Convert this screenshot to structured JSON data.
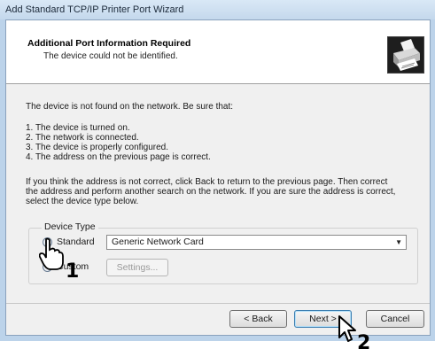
{
  "window": {
    "title": "Add Standard TCP/IP Printer Port Wizard"
  },
  "header": {
    "title": "Additional Port Information Required",
    "subtitle": "The device could not be identified."
  },
  "body": {
    "intro": "The device is not found on the network.  Be sure that:",
    "list": [
      "1.  The device is turned on.",
      "2.  The network is connected.",
      "3.  The device is properly configured.",
      "4.  The address on the previous page is correct."
    ],
    "paragraph": [
      "If you think the address is not correct, click Back to return to the previous page.  Then correct",
      "the address and perform another search on the network.  If you are sure the address is correct,",
      "select the device type below."
    ]
  },
  "device_type": {
    "group_label": "Device Type",
    "standard_label": "Standard",
    "standard_selected": true,
    "custom_label": "Custom",
    "combo_value": "Generic Network Card",
    "settings_button": "Settings..."
  },
  "footer": {
    "back_button": "< Back",
    "next_button": "Next >",
    "cancel_button": "Cancel"
  },
  "annotations": {
    "step1": "1",
    "step2": "2"
  },
  "colors": {
    "accent": "#2a6fcf",
    "title_bar": "#c4d8ec"
  },
  "icons": {
    "header": "printer-icon",
    "pointer": "hand-pointer-icon",
    "cursor": "arrow-cursor-icon"
  }
}
